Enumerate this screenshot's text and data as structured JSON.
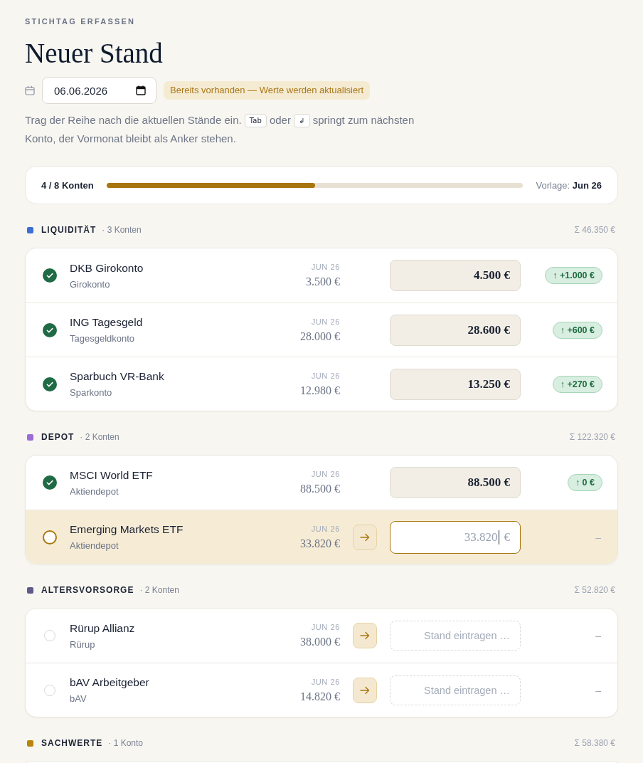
{
  "header": {
    "eyebrow": "STICHTAG ERFASSEN",
    "title": "Neuer Stand",
    "date": "06.06.2026",
    "notice": "Bereits vorhanden — Werte werden aktualisiert",
    "hint": [
      {
        "kind": "text",
        "text": "Trag der Reihe nach die aktuellen Stände ein."
      },
      {
        "kind": "key",
        "text": "Tab"
      },
      {
        "kind": "text",
        "text": "oder"
      },
      {
        "kind": "key",
        "text": "↲"
      },
      {
        "kind": "text",
        "text": "springt zum nächsten"
      },
      {
        "kind": "text",
        "text": "Konto, der Vormonat bleibt als Anker stehen."
      }
    ]
  },
  "progress": {
    "count": "4 / 8 Konten",
    "level": 0.5,
    "template": "Vorlage: **Jun 26**"
  },
  "groups": [
    {
      "name": "LIQUIDITÄT",
      "count": "· 3 Konten",
      "sum": "Σ 46.350 €",
      "color": "#3b6fd4",
      "accounts": [
        {
          "name": "DKB Girokonto",
          "type": "Girokonto",
          "prev_label": "JUN 26",
          "prev_value": "3.500 €",
          "checked": true,
          "selected": false,
          "input": {
            "value": "4.500 €"
          },
          "delta": "↑ +1.000 €"
        },
        {
          "name": "ING Tagesgeld",
          "type": "Tagesgeldkonto",
          "prev_label": "JUN 26",
          "prev_value": "28.000 €",
          "checked": true,
          "selected": false,
          "input": {
            "value": "28.600 €"
          },
          "delta": "↑ +600 €"
        },
        {
          "name": "Sparbuch VR-Bank",
          "type": "Sparkonto",
          "prev_label": "JUN 26",
          "prev_value": "12.980 €",
          "checked": true,
          "selected": false,
          "input": {
            "value": "13.250 €"
          },
          "delta": "↑ +270 €"
        }
      ]
    },
    {
      "name": "DEPOT",
      "count": "· 2 Konten",
      "sum": "Σ 122.320 €",
      "color": "#9b6bd6",
      "accounts": [
        {
          "name": "MSCI World ETF",
          "type": "Aktiendepot",
          "prev_label": "JUN 26",
          "prev_value": "88.500 €",
          "checked": true,
          "selected": false,
          "input": {
            "value": "88.500 €"
          },
          "delta": "↑ 0 €"
        },
        {
          "name": "Emerging Markets ETF",
          "type": "Aktiendepot",
          "prev_label": "JUN 26",
          "prev_value": "33.820 €",
          "checked": false,
          "selected": true,
          "input": {
            "placeholder": "33.820",
            "suffix": "€"
          },
          "delta": "–"
        }
      ]
    },
    {
      "name": "ALTERSVORSORGE",
      "count": "· 2 Konten",
      "sum": "Σ 52.820 €",
      "color": "#5e5a8c",
      "accounts": [
        {
          "name": "Rürup Allianz",
          "type": "Rürup",
          "prev_label": "JUN 26",
          "prev_value": "38.000 €",
          "checked": false,
          "selected": false,
          "input": {
            "placeholder": "Stand eintragen …"
          },
          "delta": "–"
        },
        {
          "name": "bAV Arbeitgeber",
          "type": "bAV",
          "prev_label": "JUN 26",
          "prev_value": "14.820 €",
          "checked": false,
          "selected": false,
          "input": {
            "placeholder": "Stand eintragen …"
          },
          "delta": "–"
        }
      ]
    },
    {
      "name": "SACHWERTE",
      "count": "· 1 Konto",
      "sum": "Σ 58.380 €",
      "color": "#b8860b"
    }
  ]
}
